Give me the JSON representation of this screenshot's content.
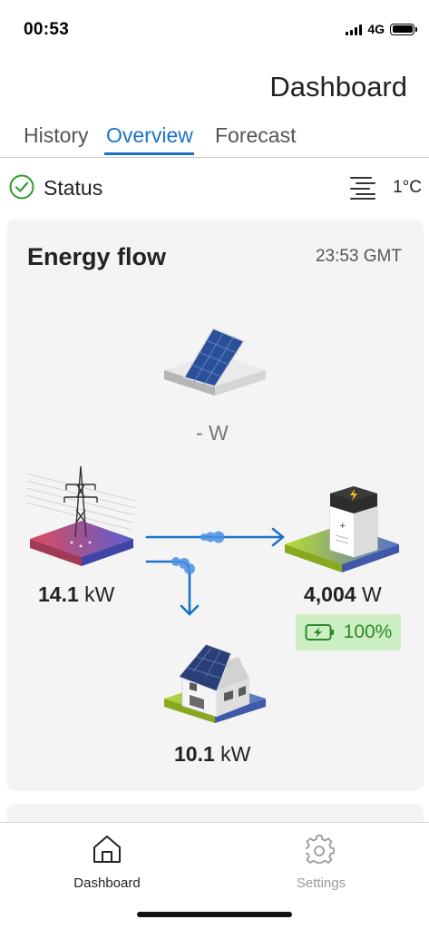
{
  "statusbar": {
    "time": "00:53",
    "network": "4G",
    "icons": [
      "signal-icon",
      "battery-icon"
    ]
  },
  "header": {
    "title": "Dashboard"
  },
  "tabs": [
    {
      "label": "History",
      "active": false
    },
    {
      "label": "Overview",
      "active": true
    },
    {
      "label": "Forecast",
      "active": false
    }
  ],
  "status": {
    "label": "Status",
    "icon": "check-circle-icon",
    "temperature": "1°C",
    "weather_icon": "fog-icon"
  },
  "energy_flow": {
    "title": "Energy flow",
    "time": "23:53 GMT",
    "pv": {
      "value": "- W",
      "icon": "solar-panel-icon"
    },
    "grid": {
      "value": "14.1",
      "unit": "kW",
      "icon": "power-pylon-icon"
    },
    "battery": {
      "value": "4,004",
      "unit": "W",
      "soc": "100%",
      "icon": "home-battery-icon"
    },
    "house": {
      "value": "10.1",
      "unit": "kW",
      "icon": "house-icon"
    }
  },
  "colors": {
    "accent": "#1a73c8",
    "ok": "#2e9b2a",
    "soc_bg": "#cdeec3"
  },
  "bottom_nav": [
    {
      "label": "Dashboard",
      "icon": "home-icon",
      "active": true
    },
    {
      "label": "Settings",
      "icon": "gear-icon",
      "active": false
    }
  ]
}
